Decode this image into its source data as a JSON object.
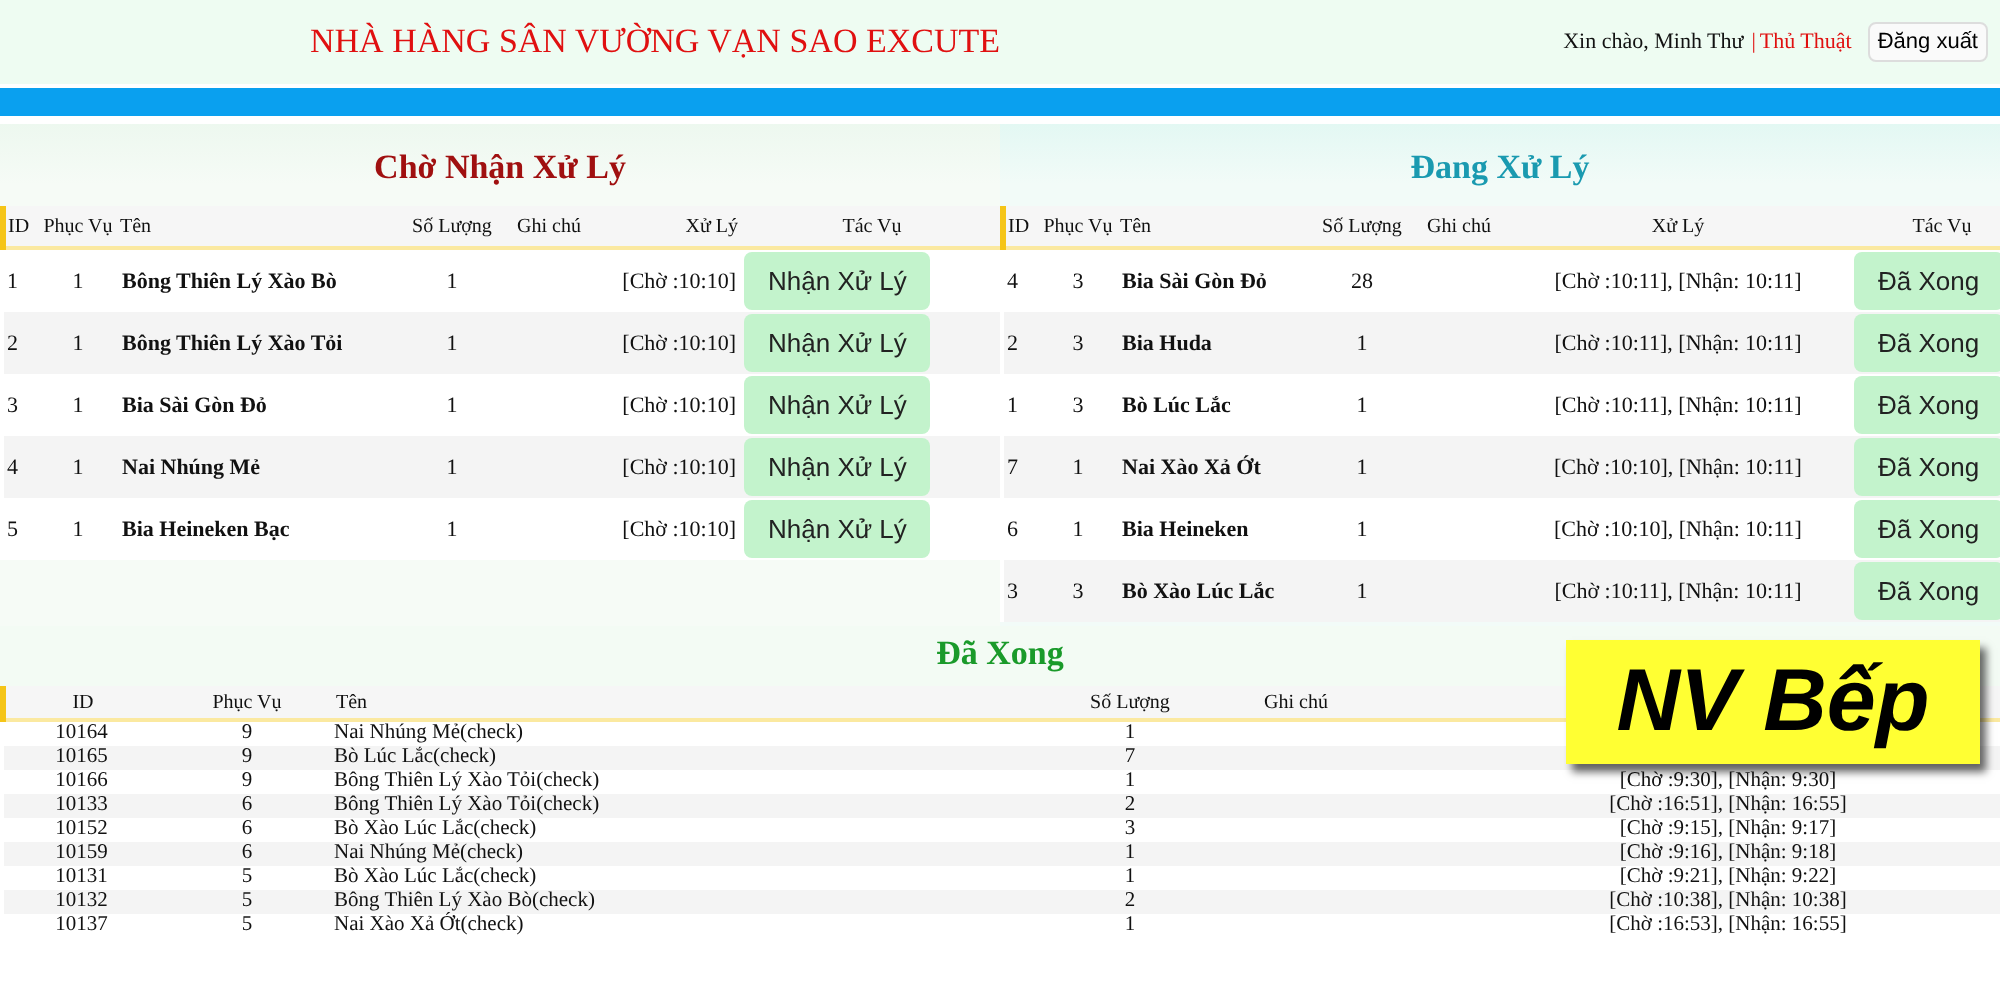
{
  "header": {
    "title": "NHÀ HÀNG SÂN VƯỜNG VẠN SAO EXCUTE",
    "greeting": "Xin chào, Minh Thư",
    "separator": "|",
    "link": "Thủ Thuật",
    "logout": "Đăng xuất"
  },
  "pending": {
    "title": "Chờ Nhận Xử Lý",
    "columns": [
      "ID",
      "Phục Vụ",
      "Tên",
      "Số Lượng",
      "Ghi chú",
      "Xử Lý",
      "Tác Vụ"
    ],
    "rows": [
      {
        "id": "1",
        "phuc_vu": "1",
        "ten": "Bông Thiên Lý Xào Bò",
        "so_luong": "1",
        "xu_ly": "[Chờ :10:10]",
        "action": "Nhận Xử Lý"
      },
      {
        "id": "2",
        "phuc_vu": "1",
        "ten": "Bông Thiên Lý Xào Tỏi",
        "so_luong": "1",
        "xu_ly": "[Chờ :10:10]",
        "action": "Nhận Xử Lý"
      },
      {
        "id": "3",
        "phuc_vu": "1",
        "ten": "Bia Sài Gòn Đỏ",
        "so_luong": "1",
        "xu_ly": "[Chờ :10:10]",
        "action": "Nhận Xử Lý"
      },
      {
        "id": "4",
        "phuc_vu": "1",
        "ten": "Nai Nhúng Mẻ",
        "so_luong": "1",
        "xu_ly": "[Chờ :10:10]",
        "action": "Nhận Xử Lý"
      },
      {
        "id": "5",
        "phuc_vu": "1",
        "ten": "Bia Heineken Bạc",
        "so_luong": "1",
        "xu_ly": "[Chờ :10:10]",
        "action": "Nhận Xử Lý"
      }
    ]
  },
  "in_progress": {
    "title": "Đang Xử Lý",
    "columns": [
      "ID",
      "Phục Vụ",
      "Tên",
      "Số Lượng",
      "Ghi chú",
      "Xử Lý",
      "Tác Vụ"
    ],
    "rows": [
      {
        "id": "4",
        "phuc_vu": "3",
        "ten": "Bia Sài Gòn Đỏ",
        "so_luong": "28",
        "xu_ly": "[Chờ :10:11], [Nhận: 10:11]",
        "action": "Đã Xong"
      },
      {
        "id": "2",
        "phuc_vu": "3",
        "ten": "Bia Huda",
        "so_luong": "1",
        "xu_ly": "[Chờ :10:11], [Nhận: 10:11]",
        "action": "Đã Xong"
      },
      {
        "id": "1",
        "phuc_vu": "3",
        "ten": "Bò Lúc Lắc",
        "so_luong": "1",
        "xu_ly": "[Chờ :10:11], [Nhận: 10:11]",
        "action": "Đã Xong"
      },
      {
        "id": "7",
        "phuc_vu": "1",
        "ten": "Nai Xào Xả Ớt",
        "so_luong": "1",
        "xu_ly": "[Chờ :10:10], [Nhận: 10:11]",
        "action": "Đã Xong"
      },
      {
        "id": "6",
        "phuc_vu": "1",
        "ten": "Bia Heineken",
        "so_luong": "1",
        "xu_ly": "[Chờ :10:10], [Nhận: 10:11]",
        "action": "Đã Xong"
      },
      {
        "id": "3",
        "phuc_vu": "3",
        "ten": "Bò Xào Lúc Lắc",
        "so_luong": "1",
        "xu_ly": "[Chờ :10:11], [Nhận: 10:11]",
        "action": "Đã Xong"
      }
    ]
  },
  "done": {
    "title": "Đã Xong",
    "columns": [
      "ID",
      "Phục Vụ",
      "Tên",
      "Số Lượng",
      "Ghi chú"
    ],
    "rows": [
      {
        "id": "10164",
        "phuc_vu": "9",
        "ten": "Nai Nhúng Mẻ(check)",
        "so_luong": "1"
      },
      {
        "id": "10165",
        "phuc_vu": "9",
        "ten": "Bò Lúc Lắc(check)",
        "so_luong": "7"
      },
      {
        "id": "10166",
        "phuc_vu": "9",
        "ten": "Bông Thiên Lý Xào Tỏi(check)",
        "so_luong": "1",
        "xu_ly": "[Chờ :9:30], [Nhận: 9:30]"
      },
      {
        "id": "10133",
        "phuc_vu": "6",
        "ten": "Bông Thiên Lý Xào Tỏi(check)",
        "so_luong": "2",
        "xu_ly": "[Chờ :16:51], [Nhận: 16:55]"
      },
      {
        "id": "10152",
        "phuc_vu": "6",
        "ten": "Bò Xào Lúc Lắc(check)",
        "so_luong": "3",
        "xu_ly": "[Chờ :9:15], [Nhận: 9:17]"
      },
      {
        "id": "10159",
        "phuc_vu": "6",
        "ten": "Nai Nhúng Mẻ(check)",
        "so_luong": "1",
        "xu_ly": "[Chờ :9:16], [Nhận: 9:18]"
      },
      {
        "id": "10131",
        "phuc_vu": "5",
        "ten": "Bò Xào Lúc Lắc(check)",
        "so_luong": "1",
        "xu_ly": "[Chờ :9:21], [Nhận: 9:22]"
      },
      {
        "id": "10132",
        "phuc_vu": "5",
        "ten": "Bông Thiên Lý Xào Bò(check)",
        "so_luong": "2",
        "xu_ly": "[Chờ :10:38], [Nhận: 10:38]"
      },
      {
        "id": "10137",
        "phuc_vu": "5",
        "ten": "Nai Xào Xả Ớt(check)",
        "so_luong": "1",
        "xu_ly": "[Chờ :16:53], [Nhận: 16:55]"
      }
    ]
  },
  "callout": {
    "text": "NV Bếp"
  }
}
